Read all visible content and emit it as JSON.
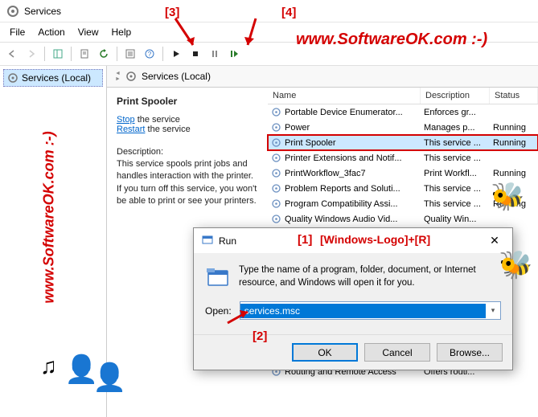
{
  "window": {
    "title": "Services"
  },
  "menu": {
    "file": "File",
    "action": "Action",
    "view": "View",
    "help": "Help"
  },
  "tree": {
    "root": "Services (Local)"
  },
  "content": {
    "header": "Services (Local)",
    "detail": {
      "name": "Print Spooler",
      "stop_pre": "Stop",
      "stop_post": " the service",
      "restart_pre": "Restart",
      "restart_post": " the service",
      "desc_label": "Description:",
      "desc": "This service spools print jobs and handles interaction with the printer. If you turn off this service, you won't be able to print or see your printers."
    },
    "columns": {
      "name": "Name",
      "desc": "Description",
      "status": "Status"
    },
    "rows": [
      {
        "name": "Portable Device Enumerator...",
        "desc": "Enforces gr...",
        "status": ""
      },
      {
        "name": "Power",
        "desc": "Manages p...",
        "status": "Running"
      },
      {
        "name": "Print Spooler",
        "desc": "This service ...",
        "status": "Running",
        "selected": true
      },
      {
        "name": "Printer Extensions and Notif...",
        "desc": "This service ...",
        "status": ""
      },
      {
        "name": "PrintWorkflow_3fac7",
        "desc": "Print Workfl...",
        "status": "Running"
      },
      {
        "name": "Problem Reports and Soluti...",
        "desc": "This service ...",
        "status": ""
      },
      {
        "name": "Program Compatibility Assi...",
        "desc": "This service ...",
        "status": "Running"
      },
      {
        "name": "Quality Windows Audio Vid...",
        "desc": "Quality Win...",
        "status": ""
      },
      {
        "name": "",
        "desc": "",
        "status": ""
      },
      {
        "name": "",
        "desc": "",
        "status": ""
      },
      {
        "name": "",
        "desc": "",
        "status": ""
      },
      {
        "name": "",
        "desc": "",
        "status": ""
      },
      {
        "name": "",
        "desc": "",
        "status": ""
      },
      {
        "name": "",
        "desc": "",
        "status": ""
      },
      {
        "name": "",
        "desc": "",
        "status": ""
      },
      {
        "name": "",
        "desc": "",
        "status": ""
      },
      {
        "name": "",
        "desc": "",
        "status": ""
      },
      {
        "name": "Routing and Remote Access",
        "desc": "Offers routi...",
        "status": ""
      }
    ]
  },
  "run": {
    "title": "Run",
    "body": "Type the name of a program, folder, document, or Internet resource, and Windows will open it for you.",
    "open_label": "Open:",
    "value": "services.msc",
    "ok": "OK",
    "cancel": "Cancel",
    "browse": "Browse..."
  },
  "annotations": {
    "a1": "[1]",
    "a1b": "[Windows-Logo]+[R]",
    "a2": "[2]",
    "a3": "[3]",
    "a4": "[4]",
    "wm": "www.SoftwareOK.com :-)"
  }
}
